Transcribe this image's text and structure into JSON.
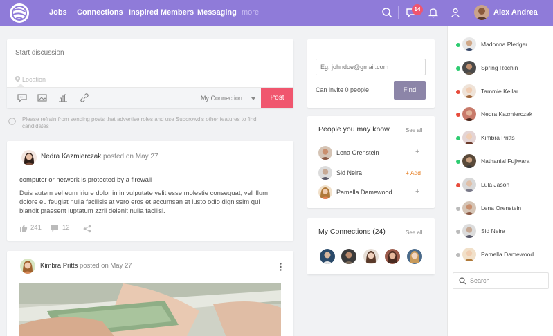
{
  "nav": {
    "links": [
      "Jobs",
      "Connections",
      "Inspired Members",
      "Messaging",
      "more"
    ],
    "notification_count": "14",
    "user_name": "Alex Andrea"
  },
  "composer": {
    "placeholder": "Start discussion",
    "location_placeholder": "Location",
    "audience": "My Connection",
    "post_label": "Post"
  },
  "notice": "Please refrain from sending posts that advertise roles and use Subcrowd's other features to find candidates",
  "posts": [
    {
      "author": "Nedra Kazmierczak",
      "meta": "posted on May 27",
      "title": "computer or network is protected by a firewall",
      "body": "Duis autem vel eum iriure dolor in in vulputate velit esse molestie consequat, vel illum dolore eu feugiat nulla facilisis at vero eros et accumsan et iusto odio dignis­sim qui blandit praesent luptatum zzril delenit nulla facilisi.",
      "likes": "241",
      "comments": "12"
    },
    {
      "author": "Kimbra Pritts",
      "meta": "posted on May 27"
    }
  ],
  "invite": {
    "email_placeholder": "Eg: johndoe@gmail.com",
    "status": "Can invite 0 people",
    "find_label": "Find"
  },
  "pymk": {
    "title": "People you may know",
    "see_all": "See all",
    "people": [
      {
        "name": "Lena Orenstein",
        "action": "+"
      },
      {
        "name": "Sid Neira",
        "action": "+ Add"
      },
      {
        "name": "Pamella Damewood",
        "action": "+"
      }
    ]
  },
  "connections": {
    "title": "My Connections (24)",
    "see_all": "See all"
  },
  "contacts": [
    {
      "name": "Madonna Pledger",
      "status": "online"
    },
    {
      "name": "Spring Rochin",
      "status": "online"
    },
    {
      "name": "Tammie Kellar",
      "status": "busy"
    },
    {
      "name": "Nedra Kazmierczak",
      "status": "busy"
    },
    {
      "name": "Kimbra Pritts",
      "status": "online"
    },
    {
      "name": "Nathanial Fujiwara",
      "status": "online"
    },
    {
      "name": "Lula Jason",
      "status": "busy"
    },
    {
      "name": "Lena Orenstein",
      "status": "offline"
    },
    {
      "name": "Sid Neira",
      "status": "offline"
    },
    {
      "name": "Pamella Damewood",
      "status": "offline"
    }
  ],
  "sidebar_search_placeholder": "Search",
  "colors": {
    "nav": "#8f7bd9",
    "post_button": "#f0566e",
    "online": "#2ecc71",
    "busy": "#e74c3c",
    "offline": "#bbbbbb"
  }
}
